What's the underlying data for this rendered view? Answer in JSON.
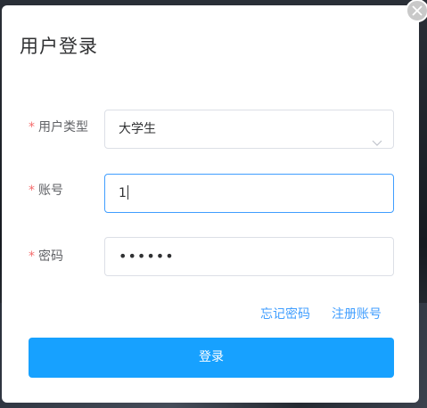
{
  "dialog": {
    "title": "用户登录",
    "close_icon": "close-icon"
  },
  "form": {
    "user_type": {
      "required_mark": "*",
      "label": "用户类型",
      "value": "大学生",
      "icon": "chevron-down-icon"
    },
    "account": {
      "required_mark": "*",
      "label": "账号",
      "value": "1"
    },
    "password": {
      "required_mark": "*",
      "label": "密码",
      "value": "••••••"
    }
  },
  "links": {
    "forgot_password": "忘记密码",
    "register": "注册账号"
  },
  "submit_label": "登录",
  "colors": {
    "accent": "#409eff",
    "button": "#17a1ff",
    "required": "#f56c6c"
  }
}
